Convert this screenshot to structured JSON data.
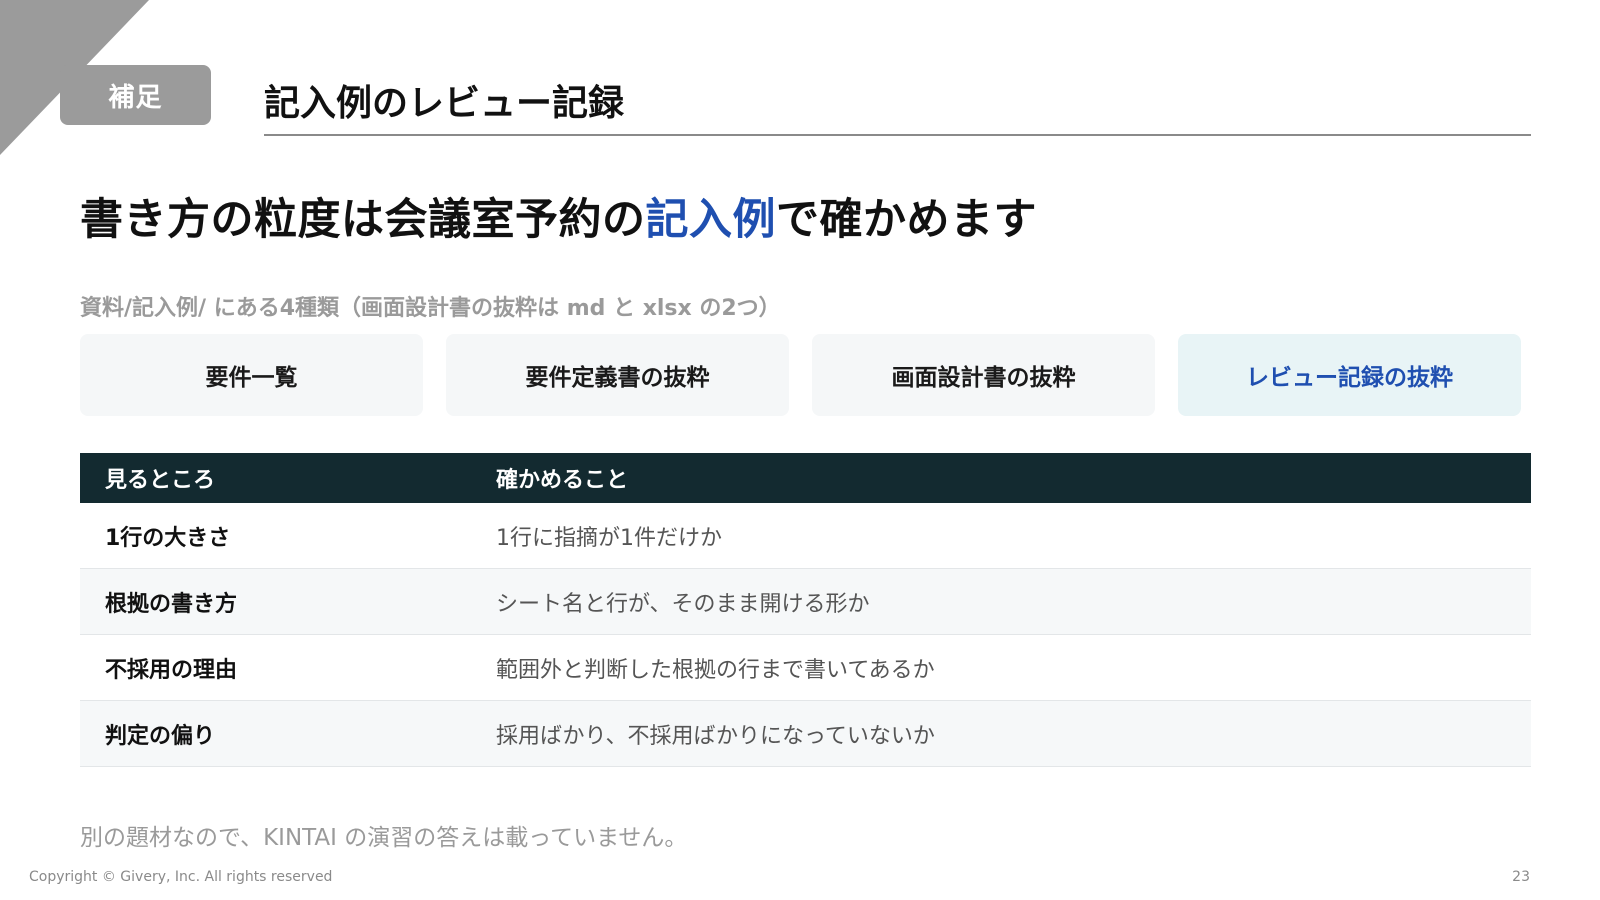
{
  "colors": {
    "accent": "#1f4fb0",
    "corner": "#9b9b9b",
    "table_header_bg": "#132a30",
    "active_card_bg": "#e8f4f6"
  },
  "header": {
    "badge": "補足",
    "title": "記入例のレビュー記録"
  },
  "headline": {
    "before": "書き方の粒度は会議室予約の",
    "accent": "記入例",
    "after": "で確かめます"
  },
  "caption": "資料/記入例/ にある4種類（画面設計書の抜粋は md と xlsx の2つ）",
  "cards": [
    {
      "label": "要件一覧",
      "active": false
    },
    {
      "label": "要件定義書の抜粋",
      "active": false
    },
    {
      "label": "画面設計書の抜粋",
      "active": false
    },
    {
      "label": "レビュー記録の抜粋",
      "active": true
    }
  ],
  "table": {
    "headers": [
      "見るところ",
      "確かめること"
    ],
    "rows": [
      [
        "1行の大きさ",
        "1行に指摘が1件だけか"
      ],
      [
        "根拠の書き方",
        "シート名と行が、そのまま開ける形か"
      ],
      [
        "不採用の理由",
        "範囲外と判断した根拠の行まで書いてあるか"
      ],
      [
        "判定の偏り",
        "採用ばかり、不採用ばかりになっていないか"
      ]
    ]
  },
  "footnote": "別の題材なので、KINTAI の演習の答えは載っていません。",
  "footer": {
    "copyright": "Copyright © Givery, Inc. All rights reserved",
    "page": "23"
  }
}
